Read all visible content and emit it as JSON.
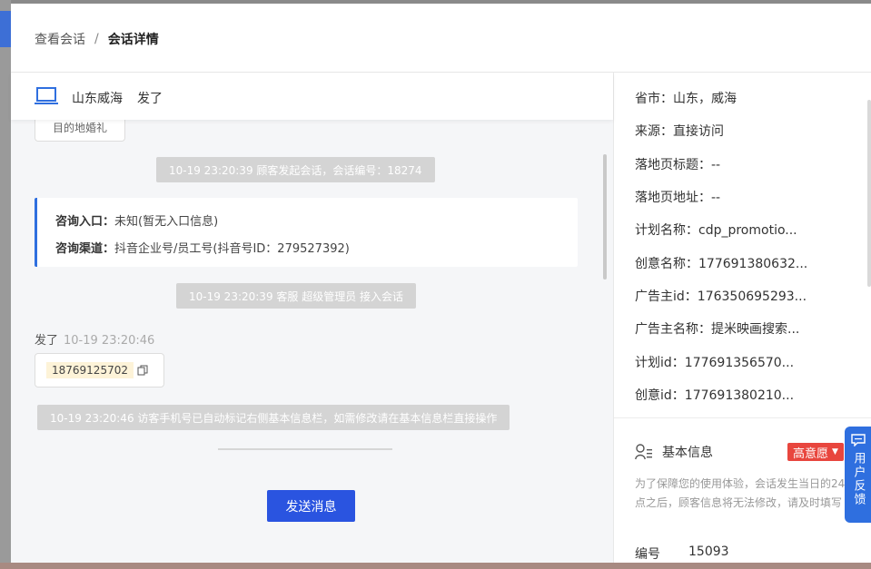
{
  "breadcrumb": {
    "parent": "查看会话",
    "separator": "/",
    "current": "会话详情"
  },
  "chat_header": {
    "location": "山东威海",
    "nickname": "发了"
  },
  "messages": {
    "top_bubble": "目的地婚礼",
    "sys1": "10-19 23:20:39 顾客发起会话，会话编号：18274",
    "info_card": {
      "entry_label": "咨询入口：",
      "entry_value": "未知(暂无入口信息)",
      "channel_label": "咨询渠道：",
      "channel_value": "抖音企业号/员工号(抖音号ID：279527392)"
    },
    "sys2": "10-19 23:20:39 客服 超级管理员 接入会话",
    "sender": "发了",
    "sender_time": "10-19 23:20:46",
    "phone": "18769125702",
    "sys3": "10-19 23:20:46 访客手机号已自动标记右侧基本信息栏，如需修改请在基本信息栏直接操作"
  },
  "send_button": "发送消息",
  "details": [
    {
      "label": "省市：",
      "value": "山东，威海"
    },
    {
      "label": "来源：",
      "value": "直接访问"
    },
    {
      "label": "落地页标题：",
      "value": "--"
    },
    {
      "label": "落地页地址：",
      "value": "--"
    },
    {
      "label": "计划名称：",
      "value": "cdp_promotio..."
    },
    {
      "label": "创意名称：",
      "value": "177691380632..."
    },
    {
      "label": "广告主id：",
      "value": "176350695293..."
    },
    {
      "label": "广告主名称：",
      "value": "提米映画搜索..."
    },
    {
      "label": "计划id：",
      "value": "177691356570..."
    },
    {
      "label": "创意id：",
      "value": "177691380210..."
    }
  ],
  "basic_info": {
    "title": "基本信息",
    "tag": "高意愿",
    "note": "为了保障您的使用体验，会话发生当日的24点之后，顾客信息将无法修改，请及时填写",
    "id_label": "编号",
    "id_value": "15093"
  },
  "feedback": "用户反馈",
  "colors": {
    "primary": "#2a54e0",
    "accent_blue": "#2f6fdf",
    "tag_red": "#e8463e"
  }
}
